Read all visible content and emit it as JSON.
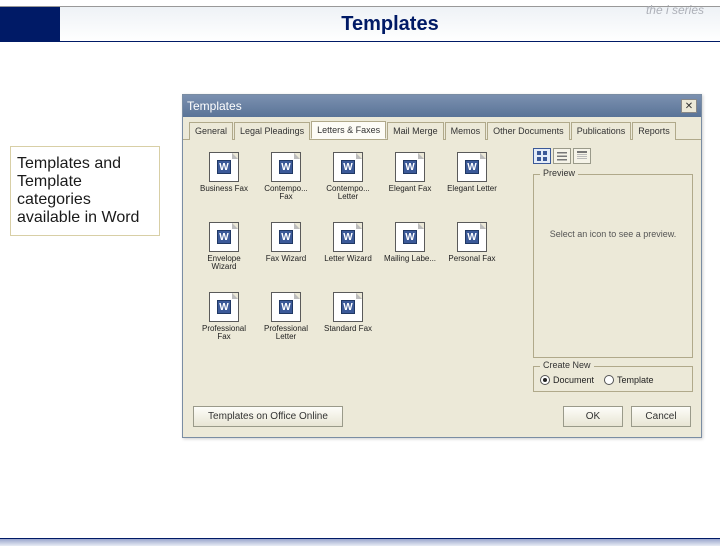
{
  "header": {
    "title": "Templates",
    "logo": "the i series"
  },
  "sidebar_note": "Templates and Template categories available in Word",
  "dialog": {
    "title": "Templates",
    "close_glyph": "✕",
    "tabs": [
      {
        "label": "General",
        "active": false
      },
      {
        "label": "Legal Pleadings",
        "active": false
      },
      {
        "label": "Letters & Faxes",
        "active": true
      },
      {
        "label": "Mail Merge",
        "active": false
      },
      {
        "label": "Memos",
        "active": false
      },
      {
        "label": "Other Documents",
        "active": false
      },
      {
        "label": "Publications",
        "active": false
      },
      {
        "label": "Reports",
        "active": false
      }
    ],
    "items": [
      {
        "label": "Business Fax"
      },
      {
        "label": "Contempo... Fax"
      },
      {
        "label": "Contempo... Letter"
      },
      {
        "label": "Elegant Fax"
      },
      {
        "label": "Elegant Letter"
      },
      {
        "label": "Envelope Wizard"
      },
      {
        "label": "Fax Wizard"
      },
      {
        "label": "Letter Wizard"
      },
      {
        "label": "Mailing Labe..."
      },
      {
        "label": "Personal Fax"
      },
      {
        "label": "Professional Fax"
      },
      {
        "label": "Professional Letter"
      },
      {
        "label": "Standard Fax"
      }
    ],
    "preview": {
      "legend": "Preview",
      "text": "Select an icon to see a preview."
    },
    "create": {
      "legend": "Create New",
      "options": [
        {
          "label": "Document",
          "checked": true
        },
        {
          "label": "Template",
          "checked": false
        }
      ]
    },
    "footer": {
      "office_online": "Templates on Office Online",
      "ok": "OK",
      "cancel": "Cancel"
    }
  }
}
